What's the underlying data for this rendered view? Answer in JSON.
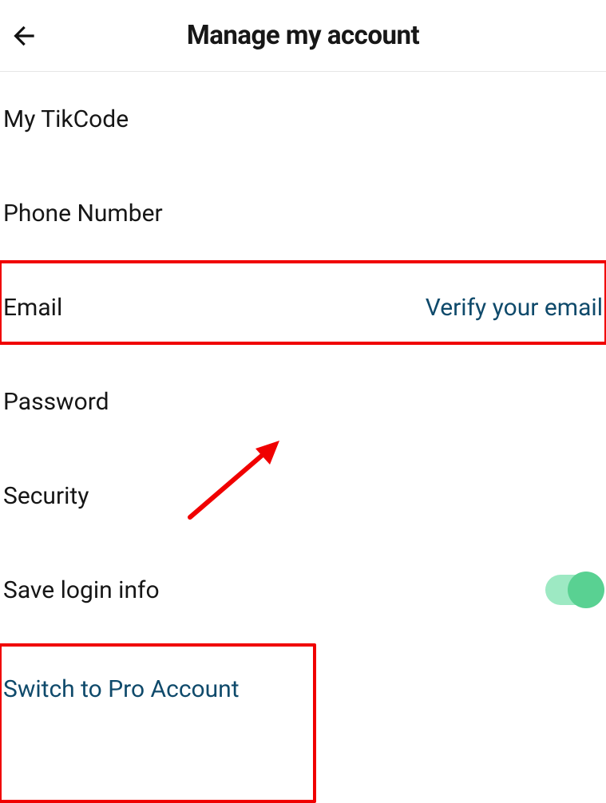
{
  "header": {
    "title": "Manage my account"
  },
  "rows": {
    "tikcode": {
      "label": "My TikCode"
    },
    "phone": {
      "label": "Phone Number"
    },
    "email": {
      "label": "Email",
      "action": "Verify your email"
    },
    "password": {
      "label": "Password"
    },
    "security": {
      "label": "Security"
    },
    "save_login": {
      "label": "Save login info",
      "toggle_on": true
    },
    "switch_pro": {
      "label": "Switch to Pro Account"
    }
  }
}
